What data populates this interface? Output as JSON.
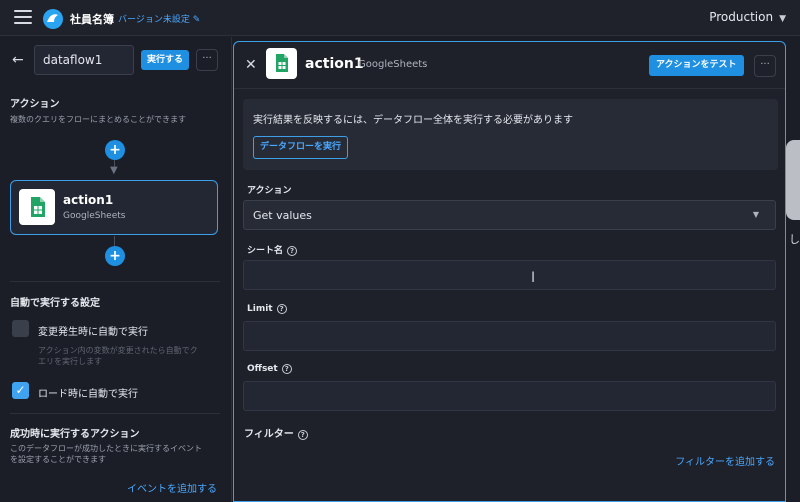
{
  "header": {
    "app_name": "社員名簿",
    "version_link": "バージョン未設定",
    "environment": "Production"
  },
  "dataflow": {
    "name": "dataflow1",
    "run_label": "実行する",
    "more_label": "···"
  },
  "actions_section": {
    "title": "アクション",
    "description": "複数のクエリをフローにまとめることができます",
    "add_symbol": "+",
    "card": {
      "title": "action1",
      "subtitle": "GoogleSheets"
    }
  },
  "auto_run_section": {
    "title": "自動で実行する設定",
    "options": [
      {
        "label": "変更発生時に自動で実行",
        "checked": false
      },
      {
        "label": "ロード時に自動で実行",
        "checked": true
      }
    ],
    "option_desc_line1": "アクション内の変数が変更されたら自動でク",
    "option_desc_line2": "エリを実行します",
    "check_mark": "✓"
  },
  "success_section": {
    "title": "成功時に実行するアクション",
    "desc_line1": "このデータフローが成功したときに実行するイベント",
    "desc_line2": "を設定することができます",
    "add_event": "イベントを追加する"
  },
  "action_panel": {
    "close": "✕",
    "title": "action1",
    "subtitle": "GoogleSheets",
    "test_button": "アクションをテスト",
    "more_label": "···",
    "notice": "実行結果を反映するには、データフロー全体を実行する必要があります",
    "run_dataflow_button": "データフローを実行",
    "action_label": "アクション",
    "action_value": "Get values",
    "sheet_label": "シート名",
    "limit_label": "Limit",
    "offset_label": "Offset",
    "filter_label": "フィルター",
    "add_filter": "フィルターを追加する",
    "help_glyph": "?"
  },
  "background": {
    "partial_text": "し"
  },
  "colors": {
    "accent": "#1e8fe1",
    "link": "#4aa8ff",
    "background": "#1b1e27"
  }
}
